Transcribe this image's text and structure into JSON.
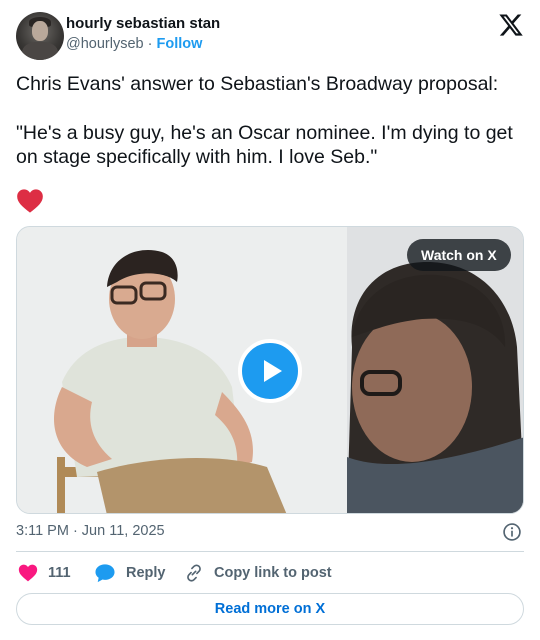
{
  "author": {
    "display_name": "hourly sebastian stan",
    "handle": "@hourlyseb",
    "separator": "·",
    "follow_label": "Follow"
  },
  "brand_icon": "x-logo-icon",
  "post": {
    "line1": "Chris Evans' answer to Sebastian's Broadway proposal:",
    "line2": "\"He's a busy guy, he's an Oscar nominee. I'm dying to get on stage specifically with him. I love Seb.\"",
    "emoji": "red-heart-emoji"
  },
  "media": {
    "watch_label": "Watch on X",
    "play_icon": "play-icon"
  },
  "timestamp": "3:11 PM · Jun 11, 2025",
  "actions": {
    "like_count": "111",
    "reply_label": "Reply",
    "copy_label": "Copy link to post"
  },
  "read_more_label": "Read more on X",
  "colors": {
    "accent": "#1d9bf0",
    "like": "#f91880",
    "text_secondary": "#536471",
    "link": "#006fd6"
  }
}
